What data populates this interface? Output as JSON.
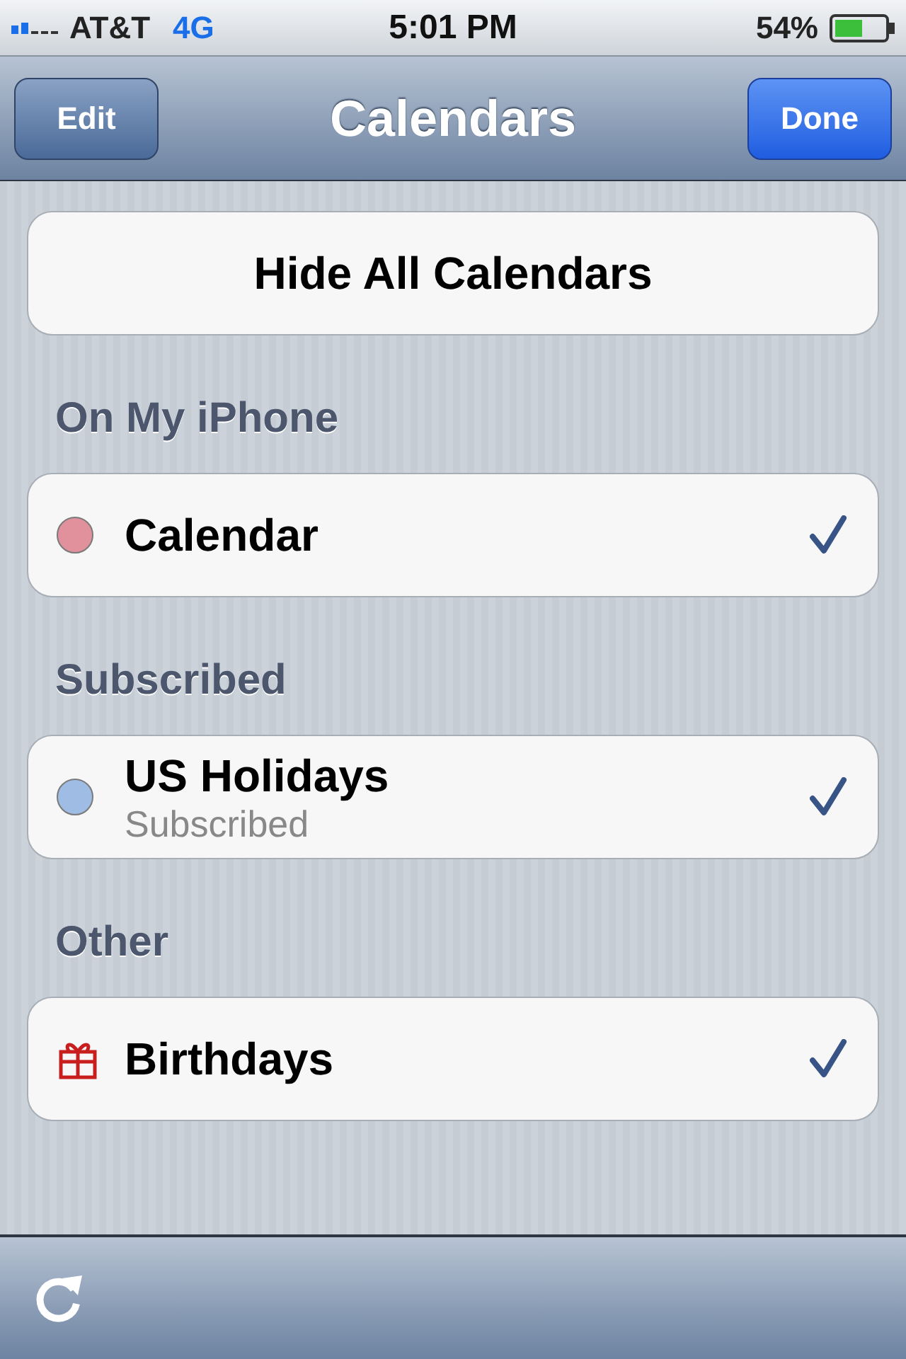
{
  "status_bar": {
    "carrier": "AT&T",
    "network": "4G",
    "time": "5:01 PM",
    "battery": "54%"
  },
  "nav_bar": {
    "left_button": "Edit",
    "title": "Calendars",
    "right_button": "Done"
  },
  "hide_all_button": "Hide All Calendars",
  "sections": [
    {
      "title": "On My iPhone",
      "items": [
        {
          "kind": "dot",
          "name": "Calendar",
          "color": "#e0919c",
          "checked": true
        }
      ]
    },
    {
      "title": "Subscribed",
      "items": [
        {
          "kind": "dot",
          "name": "US Holidays",
          "subtitle": "Subscribed",
          "color": "#9fbde4",
          "checked": true
        }
      ]
    },
    {
      "title": "Other",
      "items": [
        {
          "kind": "gift",
          "name": "Birthdays",
          "checked": true
        }
      ]
    }
  ]
}
